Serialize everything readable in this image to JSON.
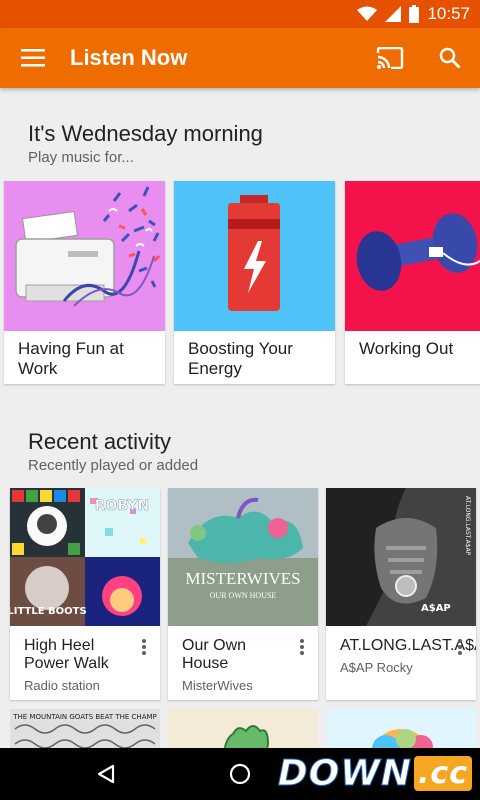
{
  "status": {
    "time": "10:57",
    "wifi_icon": "wifi-icon",
    "signal_icon": "signal-icon",
    "battery_icon": "battery-icon"
  },
  "app_bar": {
    "title": "Listen Now",
    "menu_icon": "menu-icon",
    "cast_icon": "cast-icon",
    "search_icon": "search-icon",
    "color": "#ef6c00"
  },
  "moods": {
    "title": "It's Wednesday morning",
    "subtitle": "Play music for...",
    "cards": [
      {
        "label": "Having Fun at Work",
        "art_color": "#e88ef0",
        "icon": "printer-confetti-icon"
      },
      {
        "label": "Boosting Your Energy",
        "art_color": "#4fc3f7",
        "icon": "battery-bolt-icon"
      },
      {
        "label": "Working Out",
        "art_color": "#f4124b",
        "icon": "dumbbell-icon"
      }
    ]
  },
  "recent": {
    "title": "Recent activity",
    "subtitle": "Recently played or added",
    "cards": [
      {
        "name": "High Heel Power Walk",
        "sub": "Radio station",
        "art_text": "ROBYN",
        "art_text_2": "LITTLE BOOTS"
      },
      {
        "name": "Our Own House",
        "sub": "MisterWives",
        "art_text": "MISTERWIVES",
        "art_text_2": "OUR OWN HOUSE"
      },
      {
        "name": "AT.LONG.LAST.A$AP",
        "sub": "A$AP Rocky",
        "art_text": "A$AP",
        "art_text_2": "AT.LONG.LAST.A$AP"
      }
    ],
    "peek": {
      "art_text": "THE MOUNTAIN GOATS BEAT THE CHAMP"
    }
  },
  "nav": {
    "back_icon": "back-icon",
    "home_icon": "home-icon"
  },
  "watermark": {
    "main": "DOWN",
    "tail": ".cc"
  }
}
